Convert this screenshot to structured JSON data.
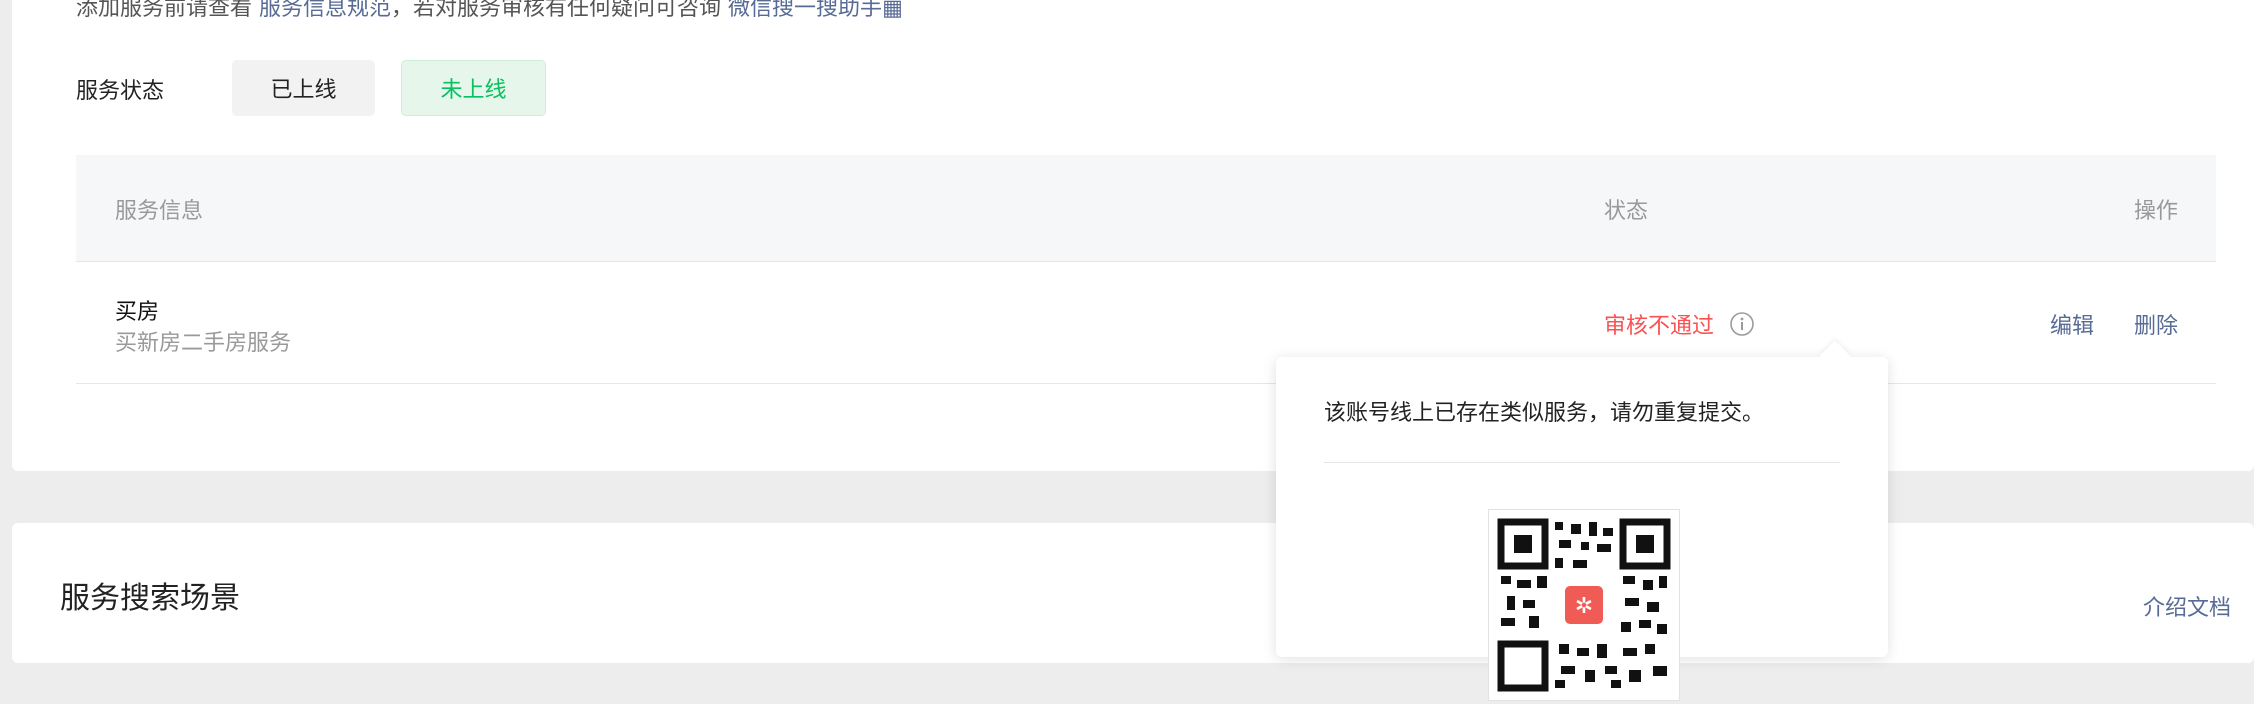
{
  "notice": {
    "prefix": "添加服务前请查看",
    "link1": "服务信息规范",
    "middle": "，若对服务审核有任何疑问可咨询",
    "link2": "微信搜一搜助手"
  },
  "filter": {
    "label": "服务状态",
    "options": [
      "已上线",
      "未上线"
    ],
    "selected": "未上线"
  },
  "table": {
    "headers": {
      "info": "服务信息",
      "status": "状态",
      "actions": "操作"
    },
    "rows": [
      {
        "name": "买房",
        "description": "买新房二手房服务",
        "status": "审核不通过",
        "actions": {
          "edit": "编辑",
          "delete": "删除"
        }
      }
    ]
  },
  "popover": {
    "message": "该账号线上已存在类似服务，请勿重复提交。",
    "qr_icon": "qr-code-icon"
  },
  "section2": {
    "title": "服务搜索场景",
    "doc_link": "介绍文档"
  },
  "colors": {
    "accent_green": "#07c160",
    "error_red": "#fa5151",
    "link_blue": "#576b95"
  }
}
